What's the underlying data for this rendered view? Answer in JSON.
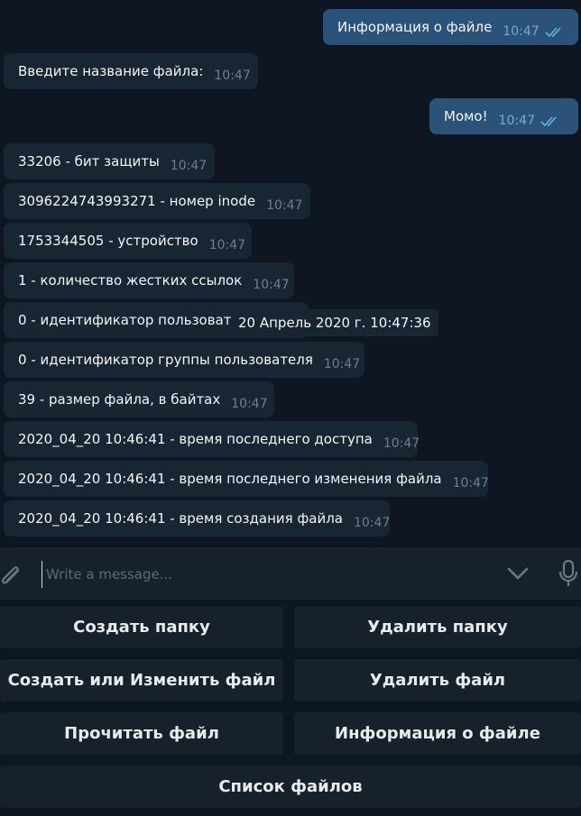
{
  "messages": [
    {
      "text": "Информация о файле",
      "time": "10:47",
      "dir": "out"
    },
    {
      "text": "Введите название файла:",
      "time": "10:47",
      "dir": "in"
    },
    {
      "text": "Момо!",
      "time": "10:47",
      "dir": "out"
    },
    {
      "text": "33206 - бит защиты",
      "time": "10:47",
      "dir": "in"
    },
    {
      "text": "3096224743993271 - номер inode",
      "time": "10:47",
      "dir": "in"
    },
    {
      "text": "1753344505 - устройство",
      "time": "10:47",
      "dir": "in"
    },
    {
      "text": "1 - количество жестких ссылок",
      "time": "10:47",
      "dir": "in"
    },
    {
      "text": "0 - идентификатор пользовате",
      "time": "",
      "dir": "in"
    },
    {
      "text": "0 - идентификатор группы пользователя",
      "time": "10:47",
      "dir": "in"
    },
    {
      "text": "39 - размер файла, в байтах",
      "time": "10:47",
      "dir": "in"
    },
    {
      "text": "2020_04_20 10:46:41 - время последнего доступа",
      "time": "10:47",
      "dir": "in"
    },
    {
      "text": "2020_04_20 10:46:41 - время последнего изменения файла",
      "time": "10:47",
      "dir": "in"
    },
    {
      "text": "2020_04_20 10:46:41 - время создания файла",
      "time": "10:47",
      "dir": "in"
    }
  ],
  "tooltip": "20 Апрель 2020 г. 10:47:36",
  "composer": {
    "placeholder": "Write a message..."
  },
  "keyboard": {
    "create_folder": "Создать папку",
    "delete_folder": "Удалить папку",
    "create_edit_file": "Создать или Изменить файл",
    "delete_file": "Удалить файл",
    "read_file": "Прочитать файл",
    "file_info": "Информация о файле",
    "list_files": "Список файлов"
  },
  "icons": {
    "attach": "paperclip-icon",
    "scroll": "chevron-down-icon",
    "voice": "microphone-icon",
    "read": "double-check-icon"
  },
  "colors": {
    "background": "#0e1621",
    "incoming": "#182533",
    "outgoing": "#2b5278",
    "panel": "#17212b",
    "check": "#5fb4ec"
  }
}
